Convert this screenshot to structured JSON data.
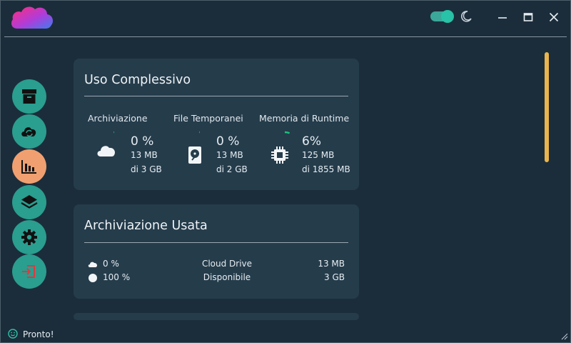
{
  "colors": {
    "background": "#1b2d3b",
    "card": "#253c4b",
    "accent_teal": "#2a9e8f",
    "accent_active": "#f0a070",
    "scrollbar": "#e9b54c",
    "logout_icon": "#e0393e"
  },
  "titlebar": {
    "theme_toggle": {
      "on": true,
      "icon": "moon-icon"
    },
    "buttons": [
      "minimize-icon",
      "maximize-icon",
      "close-icon"
    ]
  },
  "sidebar": {
    "items": [
      {
        "icon": "archive-box-icon",
        "active": false
      },
      {
        "icon": "cloud-sync-icon",
        "active": false
      },
      {
        "icon": "bar-chart-icon",
        "active": true
      },
      {
        "icon": "layers-icon",
        "active": false
      },
      {
        "icon": "gear-icon",
        "active": false
      },
      {
        "icon": "logout-icon",
        "active": false
      }
    ]
  },
  "usage_card": {
    "title": "Uso Complessivo",
    "columns": [
      {
        "label": "Archiviazione",
        "icon": "cloud-icon",
        "percent": "0 %",
        "percent_value": 0,
        "used": "13 MB",
        "total": "di 3 GB"
      },
      {
        "label": "File Temporanei",
        "icon": "hard-drive-icon",
        "percent": "0 %",
        "percent_value": 0,
        "used": "13 MB",
        "total": "di 2 GB"
      },
      {
        "label": "Memoria di Runtime",
        "icon": "cpu-chip-icon",
        "percent": "6%",
        "percent_value": 6,
        "used": "125 MB",
        "total": "di 1855 MB"
      }
    ]
  },
  "storage_card": {
    "title": "Archiviazione Usata",
    "rows": [
      {
        "icon": "cloud-icon",
        "percent": "0 %",
        "name": "Cloud Drive",
        "size": "13 MB"
      },
      {
        "icon": "circle-icon",
        "percent": "100 %",
        "name": "Disponibile",
        "size": "3 GB"
      }
    ]
  },
  "status": {
    "icon": "smiley-icon",
    "text": "Pronto!"
  }
}
